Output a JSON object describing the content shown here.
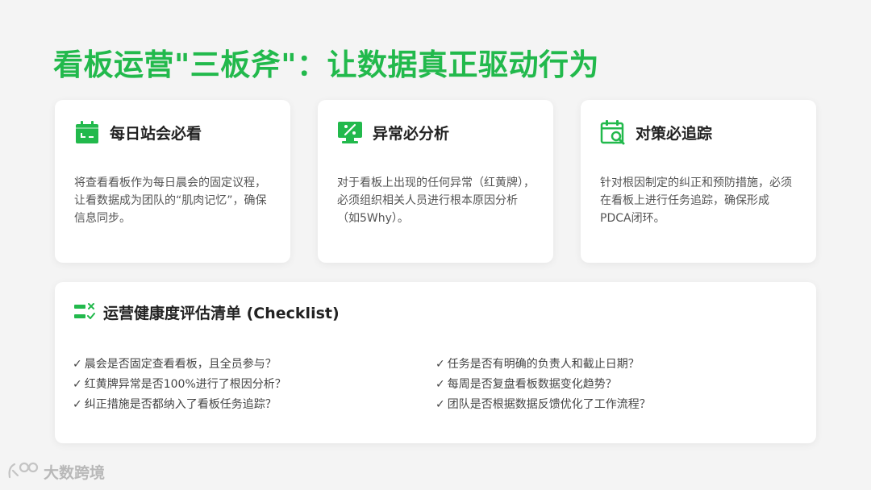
{
  "title": "看板运营\"三板斧\"：让数据真正驱动行为",
  "cards": [
    {
      "title": "每日站会必看",
      "icon": "calendar-icon",
      "desc": "将查看看板作为每日晨会的固定议程，让看数据成为团队的“肌肉记忆”，确保信息同步。"
    },
    {
      "title": "异常必分析",
      "icon": "monitor-percent-icon",
      "desc": "对于看板上出现的任何异常（红黄牌），必须组织相关人员进行根本原因分析（如5Why）。"
    },
    {
      "title": "对策必追踪",
      "icon": "calendar-search-icon",
      "desc": "针对根因制定的纠正和预防措施，必须在看板上进行任务追踪，确保形成PDCA闭环。"
    }
  ],
  "checklist": {
    "title": "运营健康度评估清单 (Checklist)",
    "icon": "checklist-icon",
    "check_mark": "✓",
    "left": [
      "晨会是否固定查看看板，且全员参与？",
      "红黄牌异常是否100%进行了根因分析？",
      "纠正措施是否都纳入了看板任务追踪？"
    ],
    "right": [
      "任务是否有明确的负责人和截止日期？",
      "每周是否复盘看板数据变化趋势？",
      "团队是否根据数据反馈优化了工作流程？"
    ]
  },
  "watermark": {
    "text": "大数跨境"
  },
  "colors": {
    "accent": "#22b94c",
    "background": "#f4f4f4",
    "card": "#ffffff",
    "text": "#222222",
    "muted": "#555555"
  }
}
